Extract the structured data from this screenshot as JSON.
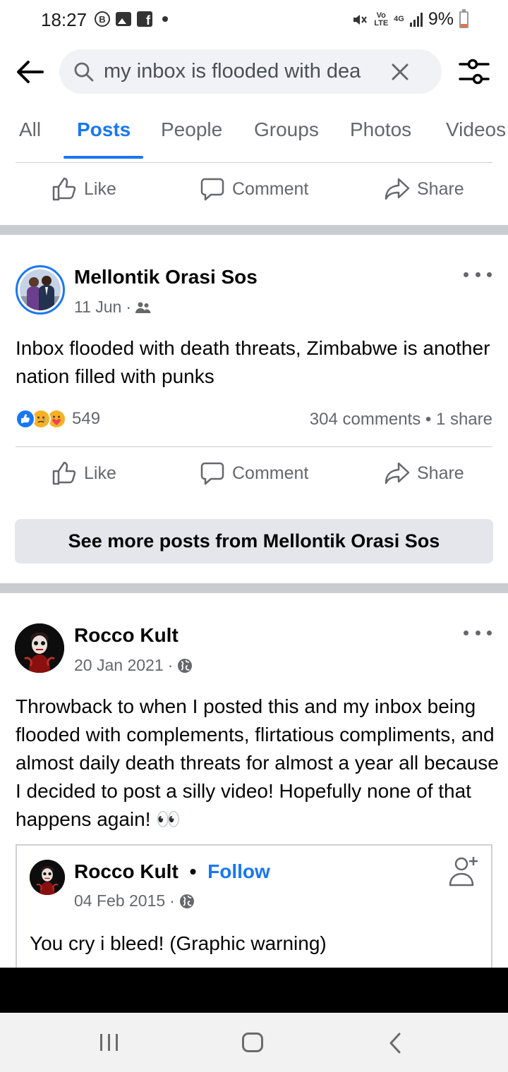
{
  "status_bar": {
    "time": "18:27",
    "left_icons": [
      "b-circle-icon",
      "gallery-icon",
      "facebook-icon",
      "dot-icon"
    ],
    "b_letter": "B",
    "fb_letter": "f",
    "vo_lte": "Vo\nLTE",
    "network": "4G",
    "battery": "9%",
    "battery_color": "#f06a45"
  },
  "search": {
    "query": "my inbox is flooded with dea"
  },
  "tabs": [
    {
      "label": "All"
    },
    {
      "label": "Posts"
    },
    {
      "label": "People"
    },
    {
      "label": "Groups"
    },
    {
      "label": "Photos"
    },
    {
      "label": "Videos"
    }
  ],
  "actions": {
    "like": "Like",
    "comment": "Comment",
    "share": "Share"
  },
  "post1": {
    "author": "Mellontik Orasi Sos",
    "date": "11 Jun",
    "audience_icon": "friends-icon",
    "text": "Inbox flooded with death threats, Zimbabwe is another  nation filled with punks",
    "reaction_icons": [
      "like-reaction-icon",
      "sad-reaction-icon",
      "care-reaction-icon"
    ],
    "reaction_count": "549",
    "comments_shares": "304 comments • 1 share",
    "see_more": "See more posts from Mellontik Orasi Sos"
  },
  "post2": {
    "author": "Rocco Kult",
    "date": "20 Jan 2021",
    "audience_icon": "globe-icon",
    "text": "Throwback to when I posted this and my inbox being flooded with complements, flirtatious compliments, and almost daily death threats for almost a year all because I decided to post a silly video! Hopefully none of that happens again! 👀",
    "shared": {
      "author": "Rocco Kult",
      "separator": "•",
      "follow": "Follow",
      "date": "04 Feb 2015",
      "text": "You cry i bleed! (Graphic warning)"
    }
  },
  "colors": {
    "accent": "#1877f2",
    "secondary_text": "#65676b",
    "divider": "#ced0d4",
    "section_gap": "#c9ccd1"
  }
}
